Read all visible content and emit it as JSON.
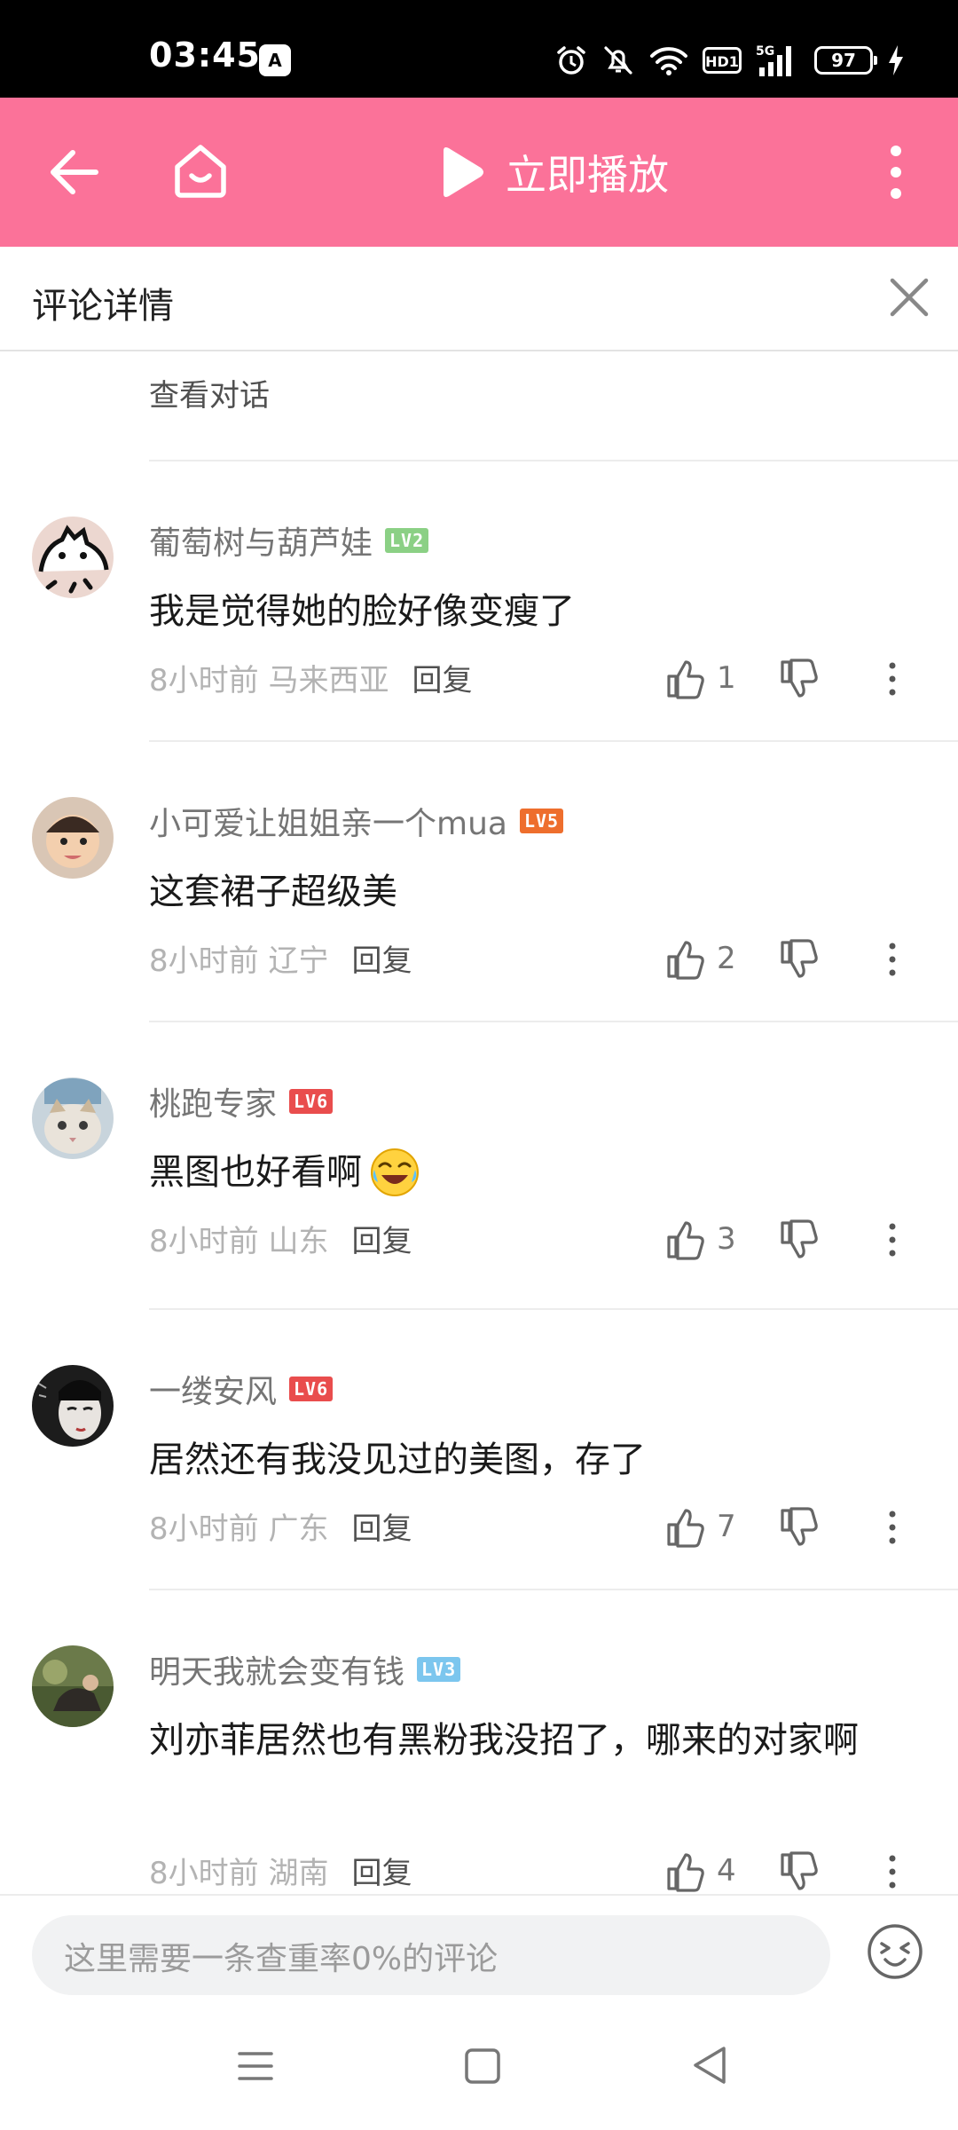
{
  "status_bar": {
    "time": "03:45",
    "ai_badge": "A",
    "network": "5G",
    "hd": "HD1",
    "battery": "97"
  },
  "toolbar": {
    "play_label": "立即播放",
    "back_icon": "back-arrow-icon",
    "home_icon": "home-icon",
    "play_icon": "play-icon",
    "more_icon": "more-vertical-icon",
    "background_color": "#fb7299"
  },
  "detail": {
    "title": "评论详情",
    "close_icon": "close-icon",
    "view_conversation": "查看对话"
  },
  "comments": [
    {
      "user": "葡萄树与葫芦娃",
      "level": "LV2",
      "level_color": "#8bd085",
      "text": "我是觉得她的脸好像变瘦了",
      "time": "8小时前 马来西亚",
      "reply": "回复",
      "likes": "1"
    },
    {
      "user": "小可爱让姐姐亲一个mua",
      "level": "LV5",
      "level_color": "#ee6e2d",
      "text": "这套裙子超级美",
      "time": "8小时前 辽宁",
      "reply": "回复",
      "likes": "2"
    },
    {
      "user": "桃跑专家",
      "level": "LV6",
      "level_color": "#e94d4d",
      "text": "黑图也好看啊",
      "time": "8小时前 山东",
      "reply": "回复",
      "likes": "3"
    },
    {
      "user": "一缕安风",
      "level": "LV6",
      "level_color": "#e94d4d",
      "text": "居然还有我没见过的美图，存了",
      "time": "8小时前 广东",
      "reply": "回复",
      "likes": "7"
    },
    {
      "user": "明天我就会变有钱",
      "level": "LV3",
      "level_color": "#7cc6ee",
      "text": "刘亦菲居然也有黑粉我没招了，哪来的对家啊",
      "time": "8小时前 湖南",
      "reply": "回复",
      "likes": "4"
    }
  ],
  "input": {
    "placeholder": "这里需要一条查重率0%的评论",
    "emoji_icon": "emoji-icon"
  },
  "nav": {
    "menu_icon": "menu-icon",
    "home_icon": "square-home-icon",
    "back_icon": "triangle-back-icon"
  }
}
